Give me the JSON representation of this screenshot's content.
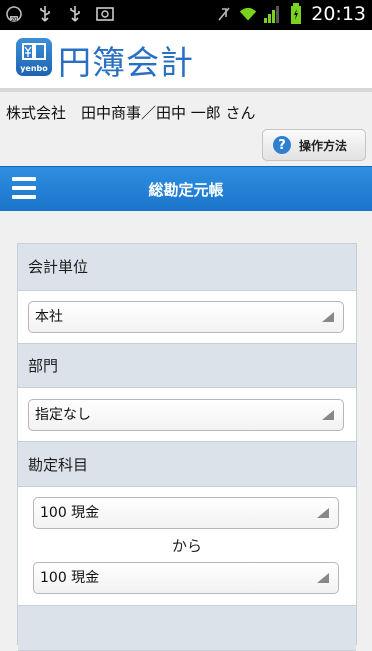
{
  "status_bar": {
    "time": "20:13",
    "left_icons": [
      "notification-icon",
      "usb-icon",
      "usb-icon",
      "picture-icon"
    ],
    "right_icons": [
      "mute-icon",
      "wifi-icon",
      "signal-icon",
      "battery-icon"
    ]
  },
  "app": {
    "logo_text": "yenbo",
    "title": "円簿会計",
    "accent_color": "#2a70c2"
  },
  "user": {
    "line": "株式会社　田中商事／田中 一郎 さん"
  },
  "help_button": {
    "label": "操作方法"
  },
  "nav": {
    "title": "総勘定元帳"
  },
  "form": {
    "unit": {
      "label": "会計単位",
      "value": "本社"
    },
    "department": {
      "label": "部門",
      "value": "指定なし"
    },
    "account": {
      "label": "勘定科目",
      "from_value": "100 現金",
      "separator": "から",
      "to_value": "100 現金"
    }
  }
}
